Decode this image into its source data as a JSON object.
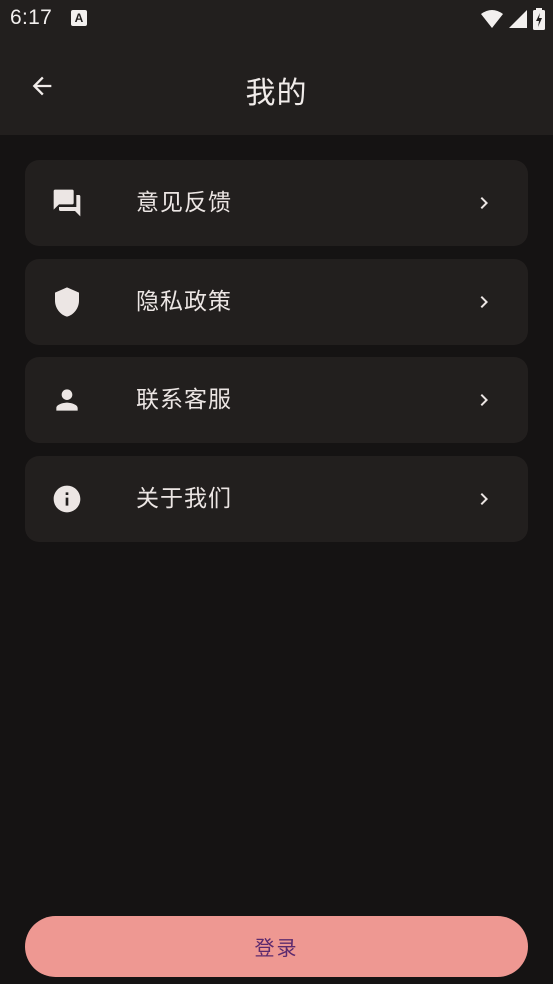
{
  "status_bar": {
    "time": "6:17",
    "notification_icon": "A"
  },
  "app_bar": {
    "title": "我的"
  },
  "menu": {
    "items": [
      {
        "label": "意见反馈",
        "icon": "feedback-icon"
      },
      {
        "label": "隐私政策",
        "icon": "shield-icon"
      },
      {
        "label": "联系客服",
        "icon": "person-icon"
      },
      {
        "label": "关于我们",
        "icon": "info-icon"
      }
    ]
  },
  "login": {
    "label": "登录"
  },
  "colors": {
    "background": "#151313",
    "surface": "#221f1e",
    "login_button": "#ee9892",
    "login_text": "#5c2a6e"
  }
}
